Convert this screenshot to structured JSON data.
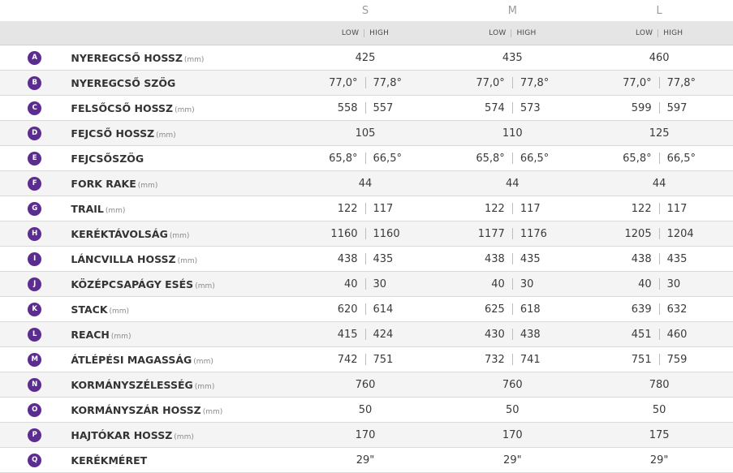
{
  "sizes": [
    "S",
    "M",
    "L"
  ],
  "sub_header": {
    "low": "LOW",
    "high": "HIGH"
  },
  "rows": [
    {
      "letter": "A",
      "label": "NYEREGCSŐ HOSSZ",
      "unit": "(mm)",
      "values": [
        {
          "single": "425"
        },
        {
          "single": "435"
        },
        {
          "single": "460"
        }
      ]
    },
    {
      "letter": "B",
      "label": "NYEREGCSŐ SZÖG",
      "unit": "",
      "values": [
        {
          "low": "77,0°",
          "high": "77,8°"
        },
        {
          "low": "77,0°",
          "high": "77,8°"
        },
        {
          "low": "77,0°",
          "high": "77,8°"
        }
      ]
    },
    {
      "letter": "C",
      "label": "FELSŐCSŐ HOSSZ",
      "unit": "(mm)",
      "values": [
        {
          "low": "558",
          "high": "557"
        },
        {
          "low": "574",
          "high": "573"
        },
        {
          "low": "599",
          "high": "597"
        }
      ]
    },
    {
      "letter": "D",
      "label": "FEJCSŐ HOSSZ",
      "unit": "(mm)",
      "values": [
        {
          "single": "105"
        },
        {
          "single": "110"
        },
        {
          "single": "125"
        }
      ]
    },
    {
      "letter": "E",
      "label": "FEJCSŐSZÖG",
      "unit": "",
      "values": [
        {
          "low": "65,8°",
          "high": "66,5°"
        },
        {
          "low": "65,8°",
          "high": "66,5°"
        },
        {
          "low": "65,8°",
          "high": "66,5°"
        }
      ]
    },
    {
      "letter": "F",
      "label": "FORK RAKE",
      "unit": "(mm)",
      "values": [
        {
          "single": "44"
        },
        {
          "single": "44"
        },
        {
          "single": "44"
        }
      ]
    },
    {
      "letter": "G",
      "label": "TRAIL",
      "unit": "(mm)",
      "values": [
        {
          "low": "122",
          "high": "117"
        },
        {
          "low": "122",
          "high": "117"
        },
        {
          "low": "122",
          "high": "117"
        }
      ]
    },
    {
      "letter": "H",
      "label": "KERÉKTÁVOLSÁG",
      "unit": "(mm)",
      "values": [
        {
          "low": "1160",
          "high": "1160"
        },
        {
          "low": "1177",
          "high": "1176"
        },
        {
          "low": "1205",
          "high": "1204"
        }
      ]
    },
    {
      "letter": "I",
      "label": "LÁNCVILLA HOSSZ",
      "unit": "(mm)",
      "values": [
        {
          "low": "438",
          "high": "435"
        },
        {
          "low": "438",
          "high": "435"
        },
        {
          "low": "438",
          "high": "435"
        }
      ]
    },
    {
      "letter": "J",
      "label": "KÖZÉPCSAPÁGY ESÉS",
      "unit": "(mm)",
      "values": [
        {
          "low": "40",
          "high": "30"
        },
        {
          "low": "40",
          "high": "30"
        },
        {
          "low": "40",
          "high": "30"
        }
      ]
    },
    {
      "letter": "K",
      "label": "STACK",
      "unit": "(mm)",
      "values": [
        {
          "low": "620",
          "high": "614"
        },
        {
          "low": "625",
          "high": "618"
        },
        {
          "low": "639",
          "high": "632"
        }
      ]
    },
    {
      "letter": "L",
      "label": "REACH",
      "unit": "(mm)",
      "values": [
        {
          "low": "415",
          "high": "424"
        },
        {
          "low": "430",
          "high": "438"
        },
        {
          "low": "451",
          "high": "460"
        }
      ]
    },
    {
      "letter": "M",
      "label": "ÁTLÉPÉSI MAGASSÁG",
      "unit": "(mm)",
      "values": [
        {
          "low": "742",
          "high": "751"
        },
        {
          "low": "732",
          "high": "741"
        },
        {
          "low": "751",
          "high": "759"
        }
      ]
    },
    {
      "letter": "N",
      "label": "KORMÁNYSZÉLESSÉG",
      "unit": "(mm)",
      "values": [
        {
          "single": "760"
        },
        {
          "single": "760"
        },
        {
          "single": "780"
        }
      ]
    },
    {
      "letter": "O",
      "label": "KORMÁNYSZÁR HOSSZ",
      "unit": "(mm)",
      "values": [
        {
          "single": "50"
        },
        {
          "single": "50"
        },
        {
          "single": "50"
        }
      ]
    },
    {
      "letter": "P",
      "label": "HAJTÓKAR HOSSZ",
      "unit": "(mm)",
      "values": [
        {
          "single": "170"
        },
        {
          "single": "170"
        },
        {
          "single": "175"
        }
      ]
    },
    {
      "letter": "Q",
      "label": "KERÉKMÉRET",
      "unit": "",
      "values": [
        {
          "single": "29\""
        },
        {
          "single": "29\""
        },
        {
          "single": "29\""
        }
      ]
    }
  ],
  "colors": {
    "badge": "#5c2d91",
    "header_band": "#e5e5e5",
    "row_alt": "#f4f4f4"
  }
}
